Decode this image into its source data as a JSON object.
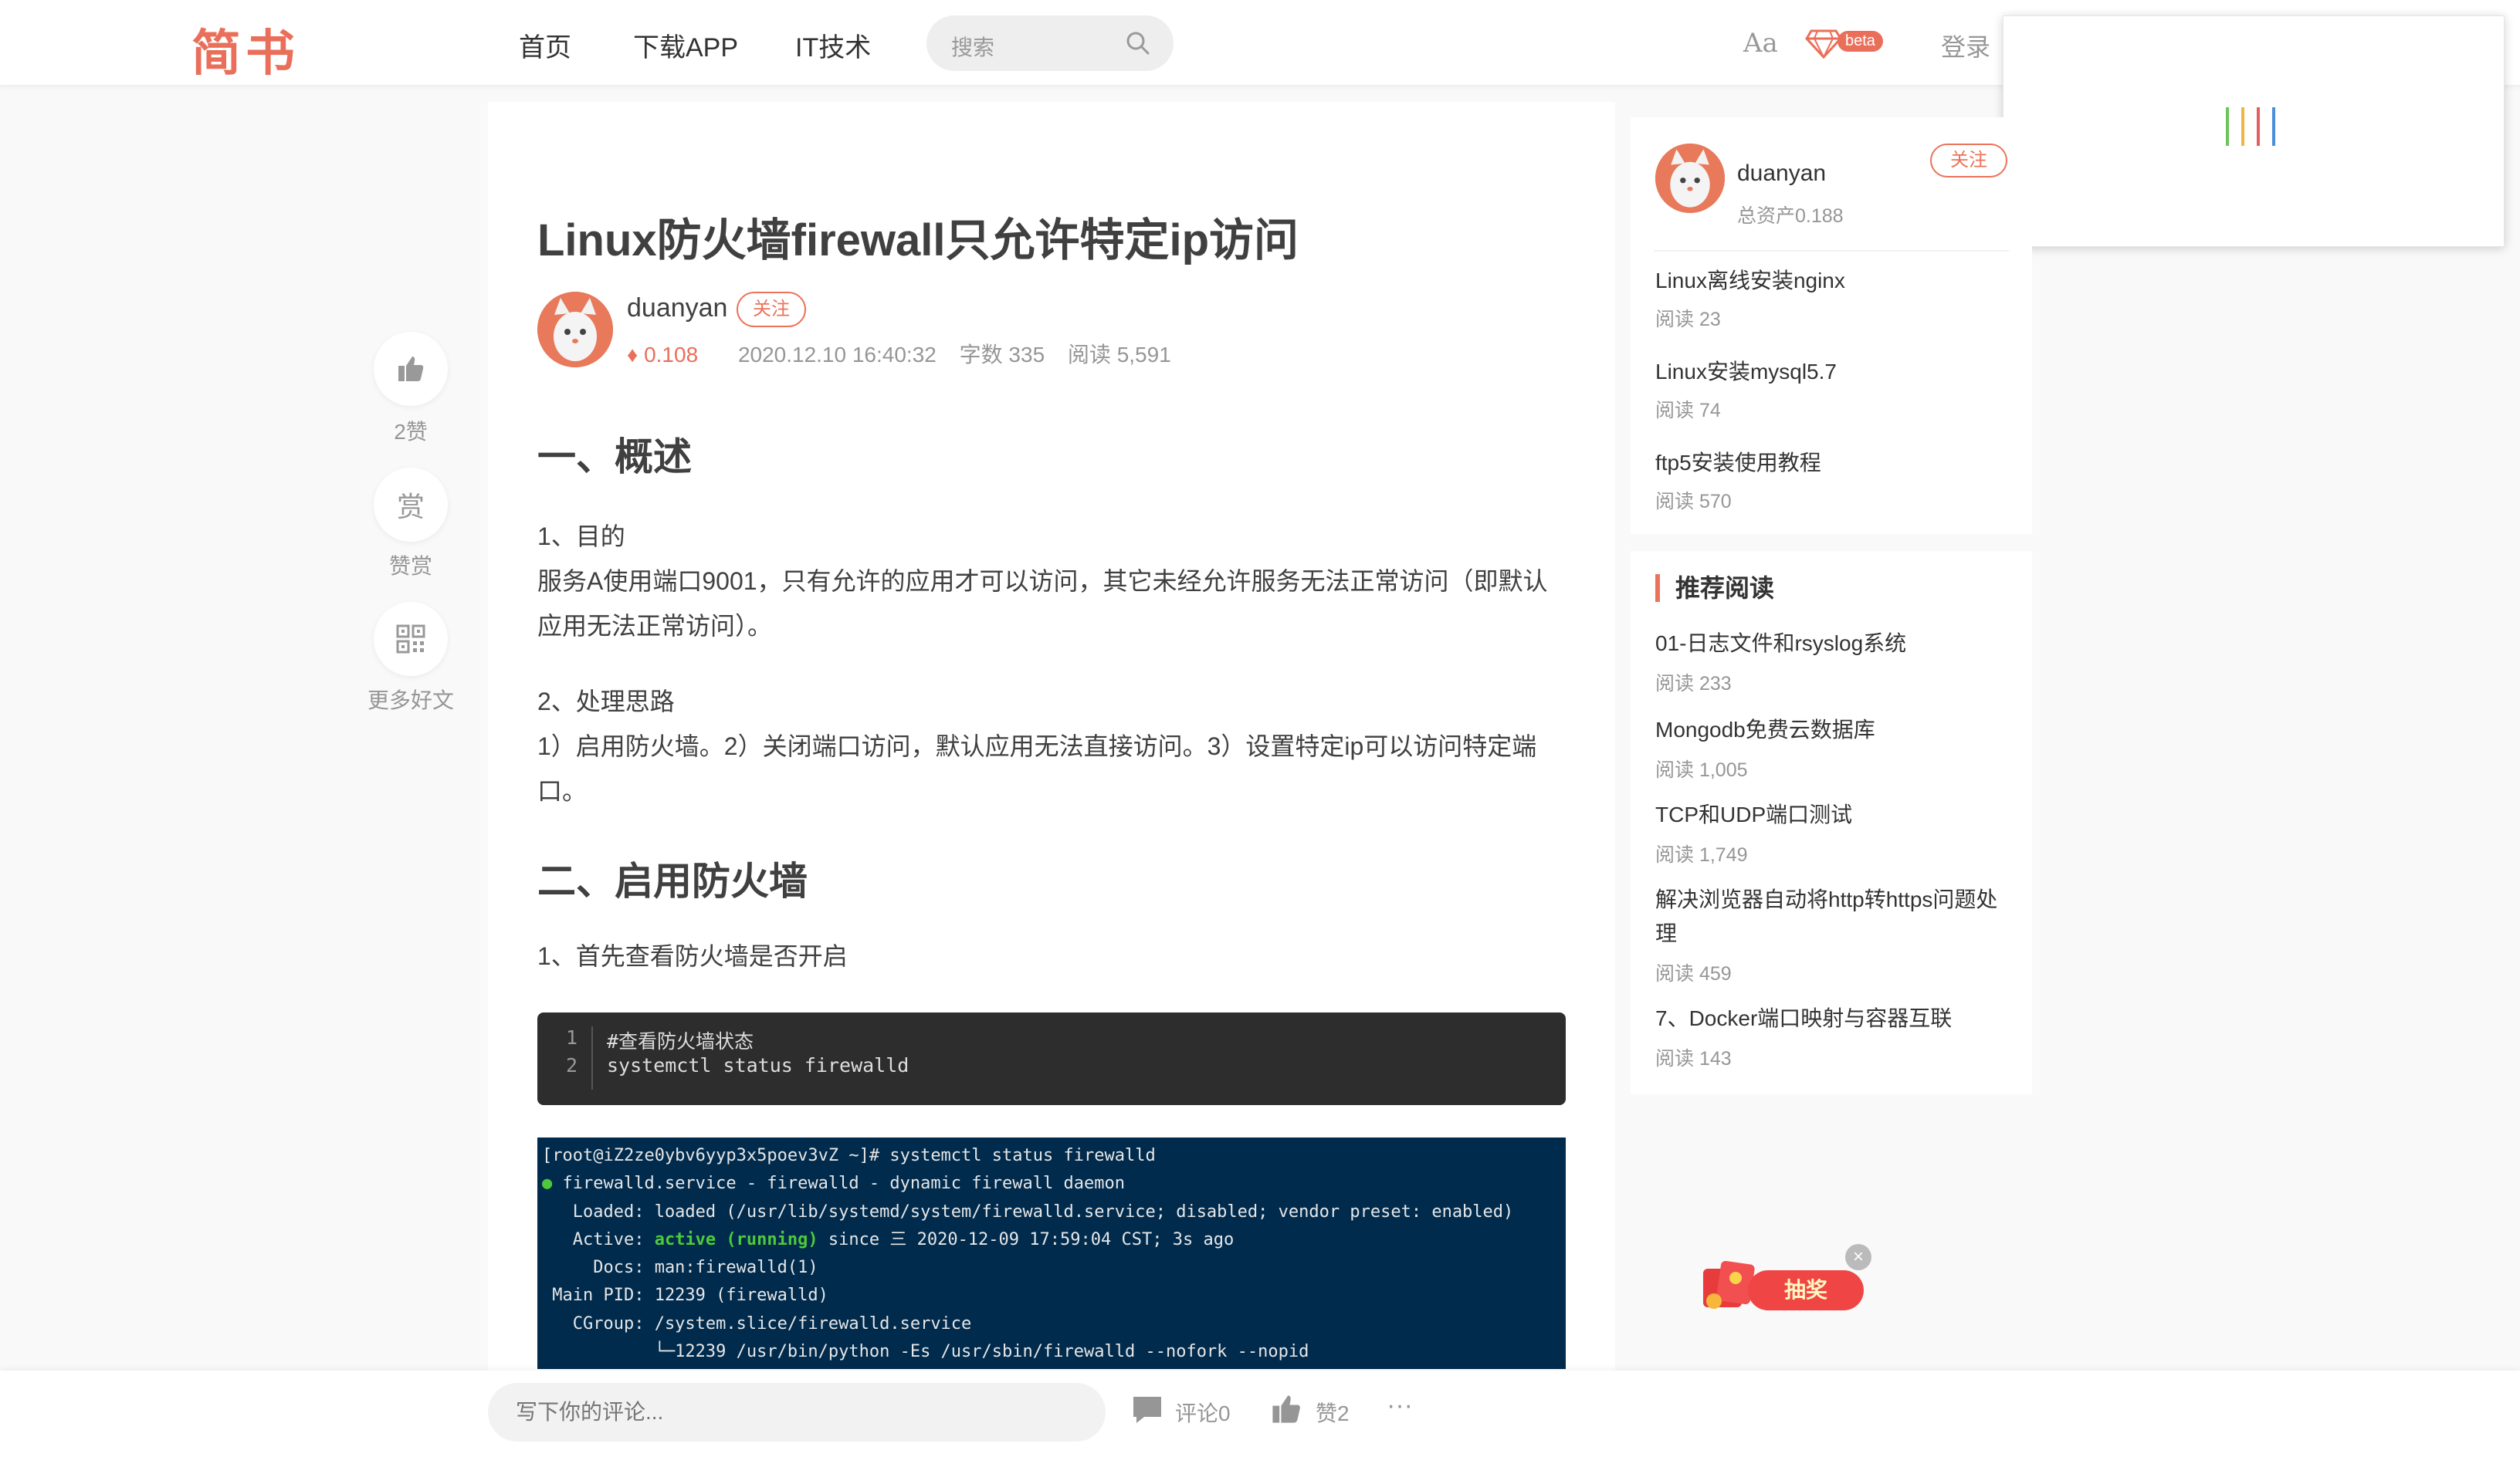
{
  "header": {
    "logo": "简书",
    "nav": [
      "首页",
      "下载APP",
      "IT技术"
    ],
    "search_placeholder": "搜索",
    "font_toggle": "Aa",
    "beta_badge": "beta",
    "login": "登录"
  },
  "side_actions": {
    "like_label": "2赞",
    "reward_glyph": "赏",
    "reward_label": "赞赏",
    "more_label": "更多好文"
  },
  "article": {
    "title": "Linux防火墙firewall只允许特定ip访问",
    "author": "duanyan",
    "follow": "关注",
    "money": "0.108",
    "date": "2020.12.10 16:40:32",
    "word_count": "字数 335",
    "reads": "阅读 5,591",
    "h2_1": "一、概述",
    "p1_line1": "1、目的",
    "p1_line2": "服务A使用端口9001，只有允许的应用才可以访问，其它未经允许服务无法正常访问（即默认应用无法正常访问）。",
    "p2_line1": "2、处理思路",
    "p2_line2": "1）启用防火墙。2）关闭端口访问，默认应用无法直接访问。3）设置特定ip可以访问特定端口。",
    "h2_2": "二、启用防火墙",
    "p3": "1、首先查看防火墙是否开启",
    "code": {
      "gutter": [
        "1",
        "2"
      ],
      "lines": [
        "#查看防火墙状态",
        "systemctl status firewalld"
      ]
    },
    "terminal": {
      "l1": "[root@iZ2ze0ybv6yyp3x5poev3vZ ~]# systemctl status firewalld",
      "l2_dot": "●",
      "l2": " firewalld.service - firewalld - dynamic firewall daemon",
      "l3": "   Loaded: loaded (/usr/lib/systemd/system/firewalld.service; disabled; vendor preset: enabled)",
      "l4_pre": "   Active: ",
      "l4_active": "active (running)",
      "l4_post": " since 三 2020-12-09 17:59:04 CST; 3s ago",
      "l5": "     Docs: man:firewalld(1)",
      "l6": " Main PID: 12239 (firewalld)",
      "l7": "   CGroup: /system.slice/firewalld.service",
      "l8": "           └─12239 /usr/bin/python -Es /usr/sbin/firewalld --nofork --nopid"
    }
  },
  "sidebar": {
    "author": "duanyan",
    "assets": "总资产0.188",
    "follow": "关注",
    "author_posts": [
      {
        "title": "Linux离线安装nginx",
        "reads": "阅读 23"
      },
      {
        "title": "Linux安装mysql5.7",
        "reads": "阅读 74"
      },
      {
        "title": "ftp5安装使用教程",
        "reads": "阅读 570"
      }
    ],
    "recommend_title": "推荐阅读",
    "recommend": [
      {
        "title": "01-日志文件和rsyslog系统",
        "reads": "阅读 233"
      },
      {
        "title": "Mongodb免费云数据库",
        "reads": "阅读 1,005"
      },
      {
        "title": "TCP和UDP端口测试",
        "reads": "阅读 1,749"
      },
      {
        "title": "解决浏览器自动将http转https问题处理",
        "reads": "阅读 459"
      },
      {
        "title": "7、Docker端口映射与容器互联",
        "reads": "阅读 143"
      }
    ]
  },
  "lottery": {
    "label": "抽奖",
    "close": "×"
  },
  "footer": {
    "comment_placeholder": "写下你的评论...",
    "comments": "评论0",
    "likes": "赞2",
    "more": "···"
  },
  "colors": {
    "accent": "#ea6f5a",
    "terminal_bg": "#002b4d",
    "code_bg": "#2d2d2d"
  }
}
